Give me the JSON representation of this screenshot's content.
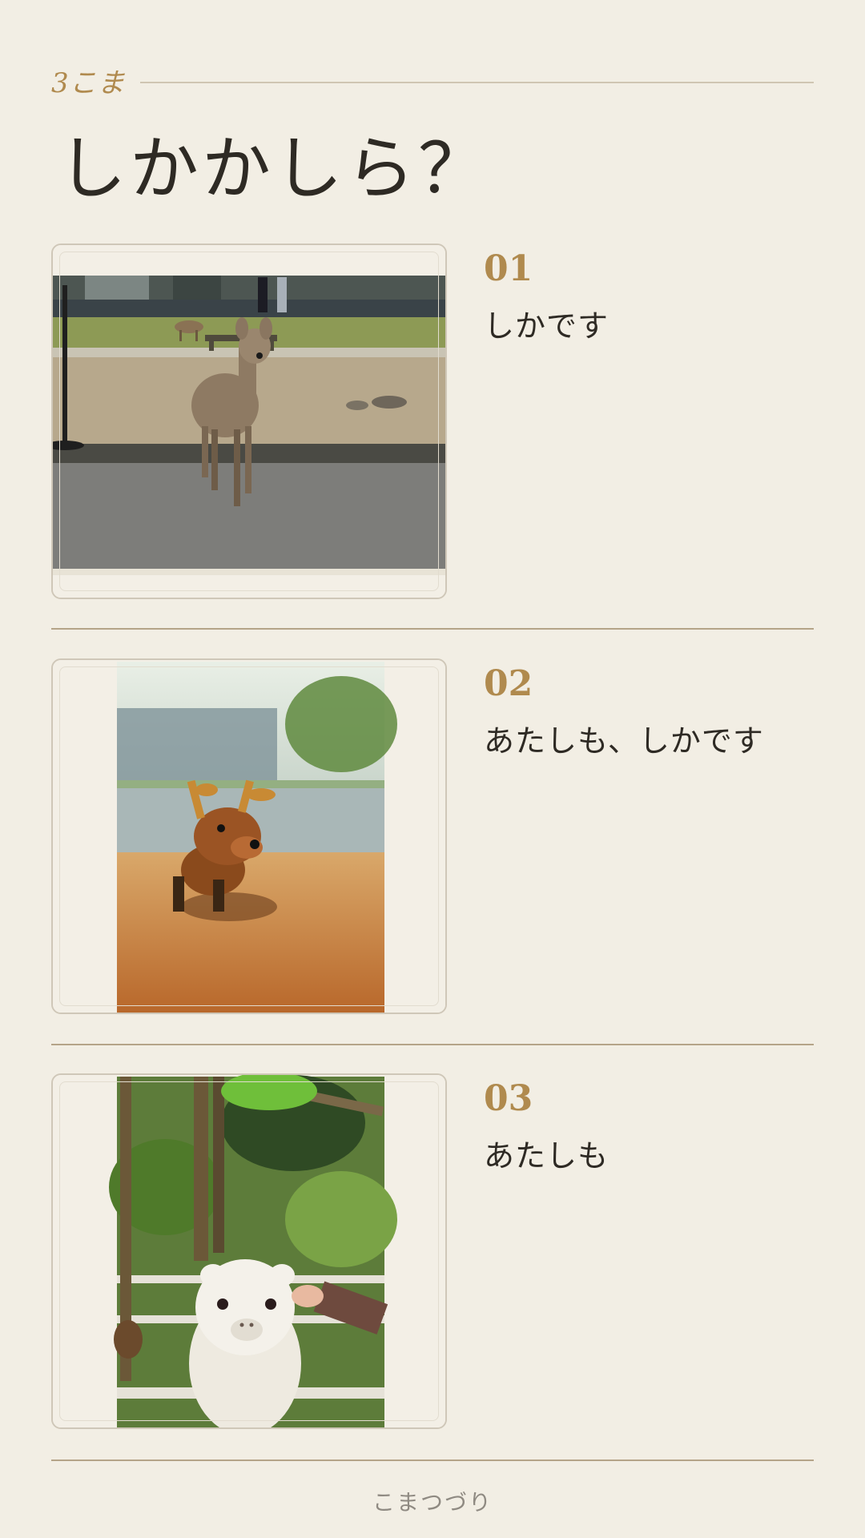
{
  "header": {
    "kicker": "3こま",
    "title": "しかかしら？"
  },
  "entries": [
    {
      "number": "01",
      "caption": "しかです",
      "photo": "deer-in-park-photo"
    },
    {
      "number": "02",
      "caption": "あたしも、しかです",
      "photo": "deer-plush-toy-photo"
    },
    {
      "number": "03",
      "caption": "あたしも",
      "photo": "alpaca-photo"
    }
  ],
  "footer": {
    "text": "こまつづり"
  },
  "colors": {
    "background": "#f2eee4",
    "accent": "#b08a4e",
    "text": "#2e2a24",
    "divider": "#b5a488"
  }
}
